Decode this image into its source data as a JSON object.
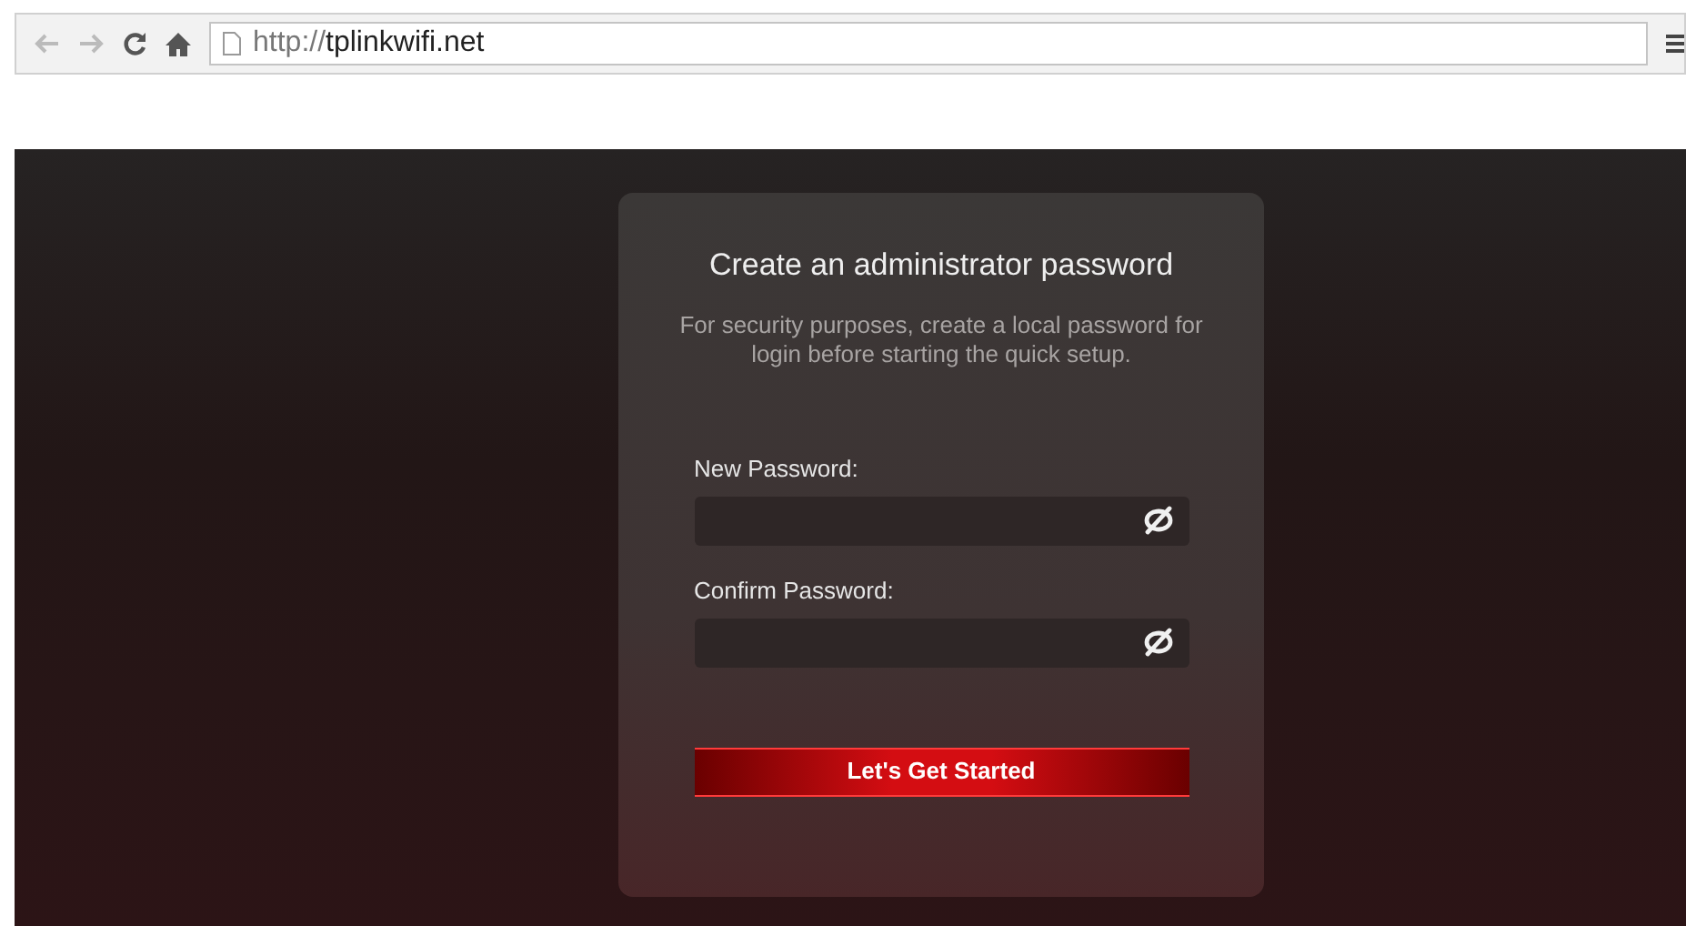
{
  "browser": {
    "url_scheme": "http://",
    "url_host": "tplinkwifi.net"
  },
  "card": {
    "title": "Create an administrator password",
    "description": "For security purposes, create a local password for login before starting the quick setup.",
    "fields": [
      {
        "label": "New Password:"
      },
      {
        "label": "Confirm Password:"
      }
    ],
    "button": "Let's Get Started"
  }
}
